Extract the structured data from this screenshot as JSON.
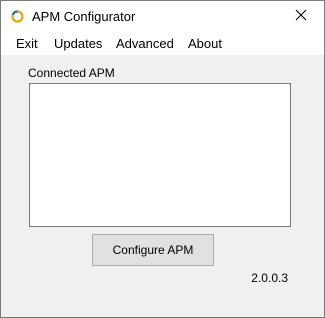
{
  "window": {
    "title": "APM Configurator",
    "app_icon": "ring-icon",
    "close_icon": "close-icon"
  },
  "menu": {
    "items": [
      {
        "label": "Exit"
      },
      {
        "label": "Updates"
      },
      {
        "label": "Advanced"
      },
      {
        "label": "About"
      }
    ]
  },
  "main": {
    "connected_label": "Connected APM",
    "connected_items": [],
    "configure_button_label": "Configure APM",
    "version": "2.0.0.3"
  },
  "colors": {
    "window_bg": "#f0f0f0",
    "titlebar_bg": "#ffffff",
    "button_bg": "#e1e1e1",
    "icon_ring": "#e2a814"
  }
}
